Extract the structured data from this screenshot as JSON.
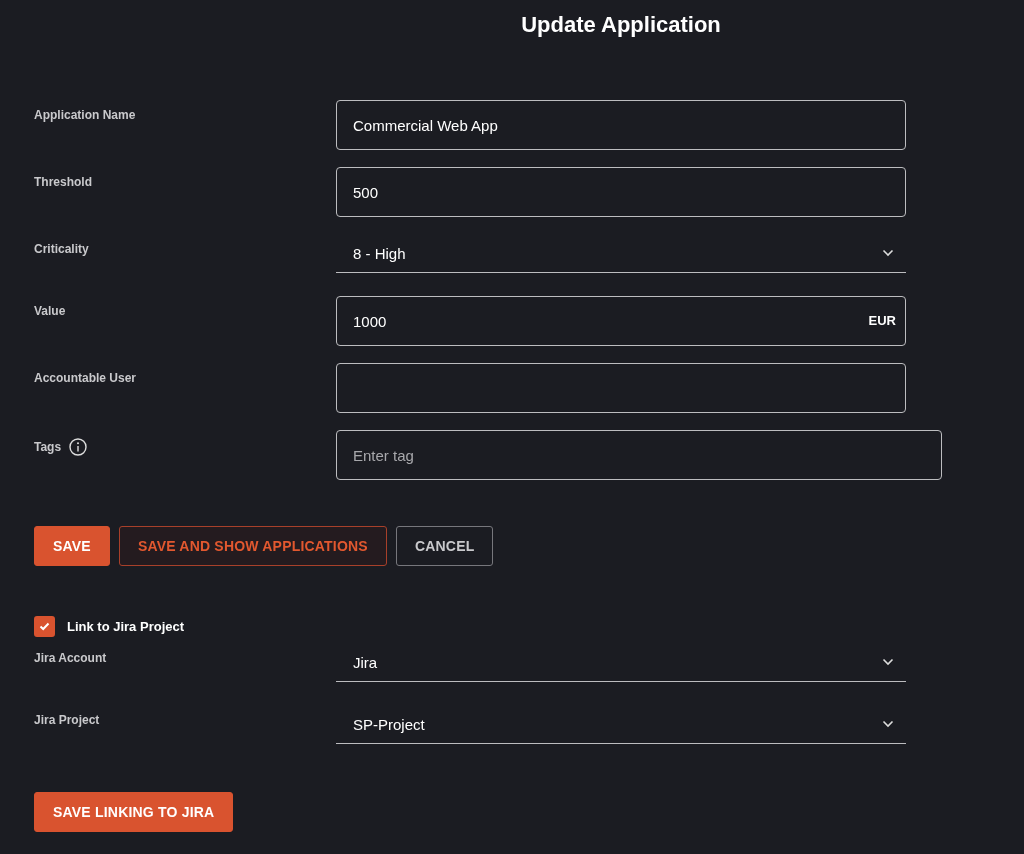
{
  "title": "Update Application",
  "fields": [
    {
      "label": "Application Name",
      "kind": "text",
      "value": "Commercial Web App"
    },
    {
      "label": "Threshold",
      "kind": "text",
      "value": "500"
    },
    {
      "label": "Criticality",
      "kind": "select",
      "value": "8 - High"
    },
    {
      "label": "Value",
      "kind": "text",
      "value": "1000",
      "suffix": "EUR"
    },
    {
      "label": "Accountable User",
      "kind": "text"
    },
    {
      "label": "Tags",
      "kind": "text",
      "placeholder": "Enter tag",
      "info": true,
      "wide": true
    }
  ],
  "buttons": [
    {
      "label": "SAVE",
      "kind": "primary"
    },
    {
      "label": "SAVE AND SHOW APPLICATIONS",
      "kind": "outline"
    },
    {
      "label": "CANCEL",
      "kind": "secondary"
    }
  ],
  "jira": {
    "link_checkbox": {
      "label": "Link to Jira Project",
      "checked": true
    },
    "fields": [
      {
        "label": "Jira Account",
        "kind": "select",
        "value": "Jira"
      },
      {
        "label": "Jira Project",
        "kind": "select",
        "value": "SP-Project"
      }
    ],
    "button": {
      "label": "SAVE LINKING TO JIRA",
      "kind": "primary"
    }
  }
}
